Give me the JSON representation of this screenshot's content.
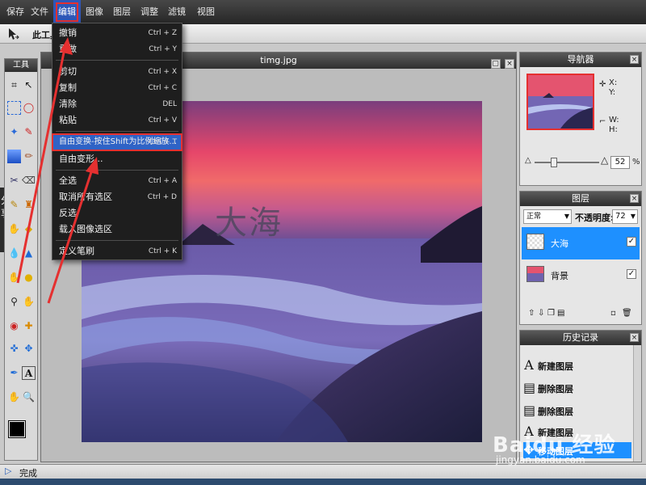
{
  "menubar": {
    "items": [
      "保存",
      "文件",
      "编辑",
      "图像",
      "图层",
      "调整",
      "滤镜",
      "视图"
    ]
  },
  "options": {
    "text": "此工具"
  },
  "tools": {
    "title": "工具"
  },
  "share_tab": "分享",
  "document": {
    "title": "timg.jpg",
    "layer_text": "大海"
  },
  "edit_menu": {
    "items": [
      {
        "label": "撤销",
        "shortcut": "Ctrl + Z"
      },
      {
        "label": "重做",
        "shortcut": "Ctrl + Y"
      },
      {
        "label": "剪切",
        "shortcut": "Ctrl + X"
      },
      {
        "label": "复制",
        "shortcut": "Ctrl + C"
      },
      {
        "label": "清除",
        "shortcut": "DEL"
      },
      {
        "label": "粘贴",
        "shortcut": "Ctrl + V"
      },
      {
        "label": "自由变换-按住Shift为比例缩放...",
        "shortcut": "Ctrl + T"
      },
      {
        "label": "自由变形...",
        "shortcut": ""
      },
      {
        "label": "全选",
        "shortcut": "Ctrl + A"
      },
      {
        "label": "取消所有选区",
        "shortcut": "Ctrl + D"
      },
      {
        "label": "反选",
        "shortcut": ""
      },
      {
        "label": "载入图像选区",
        "shortcut": ""
      },
      {
        "label": "定义笔刷",
        "shortcut": "Ctrl + K"
      }
    ]
  },
  "navigator": {
    "title": "导航器",
    "x_label": "X:",
    "y_label": "Y:",
    "w_label": "W:",
    "h_label": "H:",
    "zoom_value": "52",
    "zoom_unit": "%"
  },
  "layers": {
    "title": "图层",
    "blend_mode": "正常",
    "opacity_label": "不透明度:",
    "opacity_value": "72",
    "items": [
      {
        "name": "大海",
        "checked": "✓"
      },
      {
        "name": "背景",
        "checked": "✓"
      }
    ]
  },
  "history": {
    "title": "历史记录",
    "items": [
      "新建图层",
      "删除图层",
      "删除图层",
      "新建图层",
      "移动图层"
    ]
  },
  "status": {
    "text": "完成"
  },
  "watermark": {
    "brand": "Baidu 经验",
    "url": "jingyan.baidu.com"
  },
  "colors": {
    "accent": "#1e90ff",
    "annotation": "#e53030",
    "menu_highlight": "#2f63c6"
  }
}
